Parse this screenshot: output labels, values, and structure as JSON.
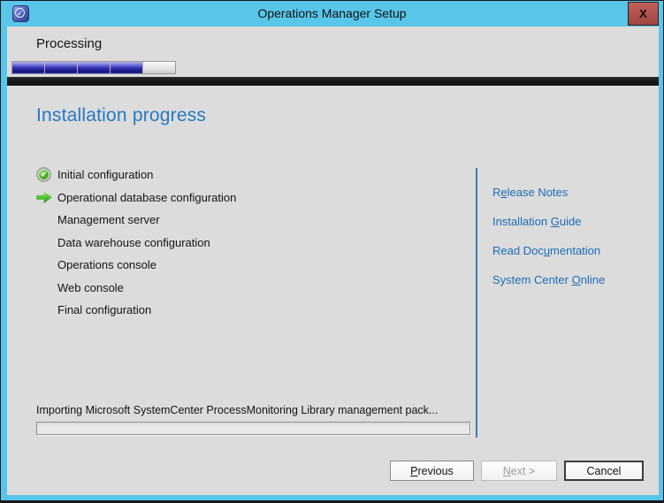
{
  "window": {
    "title": "Operations Manager Setup",
    "close_label": "X"
  },
  "header": {
    "title": "Processing",
    "progress_segments_total": 5,
    "progress_segments_filled": 4
  },
  "main": {
    "heading": "Installation progress",
    "steps": [
      {
        "label": "Initial configuration",
        "status": "done",
        "icon": "check-icon"
      },
      {
        "label": "Operational database configuration",
        "status": "current",
        "icon": "arrow-icon"
      },
      {
        "label": "Management server",
        "status": "pending",
        "icon": "none"
      },
      {
        "label": "Data warehouse configuration",
        "status": "pending",
        "icon": "none"
      },
      {
        "label": "Operations console",
        "status": "pending",
        "icon": "none"
      },
      {
        "label": "Web console",
        "status": "pending",
        "icon": "none"
      },
      {
        "label": "Final configuration",
        "status": "pending",
        "icon": "none"
      }
    ],
    "links": [
      {
        "prefix": "R",
        "key": "e",
        "suffix": "lease Notes"
      },
      {
        "prefix": "Installation ",
        "key": "G",
        "suffix": "uide"
      },
      {
        "prefix": "Read Doc",
        "key": "u",
        "suffix": "mentation"
      },
      {
        "prefix": "System Center ",
        "key": "O",
        "suffix": "nline"
      }
    ],
    "status_text": "Importing Microsoft SystemCenter ProcessMonitoring Library management pack...",
    "task_progress_percent": 0
  },
  "footer": {
    "previous": {
      "prefix": "",
      "key": "P",
      "suffix": "revious"
    },
    "next": {
      "prefix": "",
      "key": "N",
      "suffix": "ext >"
    },
    "cancel": {
      "prefix": "Cancel",
      "key": "",
      "suffix": ""
    }
  },
  "colors": {
    "titlebar_blue": "#58c6e8",
    "close_red": "#b0504c",
    "heading_blue": "#2579c2",
    "link_blue": "#1d6db6",
    "progress_fill_blue": "#2e2eb2",
    "step_done_green": "#3f9e22",
    "panel_gray": "#dcdcdc",
    "dark_band": "#1a1a1a"
  }
}
